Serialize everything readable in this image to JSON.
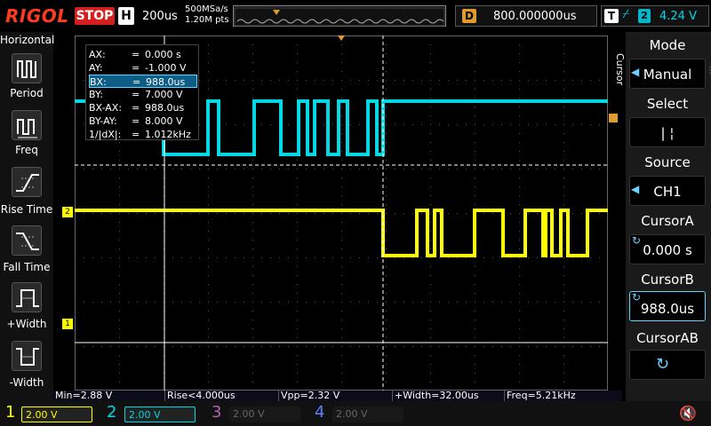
{
  "brand": "RIGOL",
  "run_state": "STOP",
  "horizontal": {
    "label": "H",
    "timebase": "200us",
    "sample_rate": "500MSa/s",
    "points": "1.20M pts"
  },
  "delay": {
    "label": "D",
    "value": "800.000000us"
  },
  "trigger": {
    "label": "T",
    "edge_icon": "rising-edge-icon",
    "channel": "2",
    "level": "4.24 V"
  },
  "left_menu": {
    "title": "Horizontal",
    "items": [
      {
        "label": "Period",
        "icon": "period-icon"
      },
      {
        "label": "Freq",
        "icon": "freq-icon"
      },
      {
        "label": "Rise Time",
        "icon": "rise-time-icon"
      },
      {
        "label": "Fall Time",
        "icon": "fall-time-icon"
      },
      {
        "label": "+Width",
        "icon": "plus-width-icon"
      },
      {
        "label": "-Width",
        "icon": "minus-width-icon"
      }
    ]
  },
  "cursor_table": [
    {
      "key": "AX:",
      "eq": "=",
      "val": "0.000 s"
    },
    {
      "key": "AY:",
      "eq": "=",
      "val": "-1.000 V"
    },
    {
      "key": "BX:",
      "eq": "=",
      "val": "988.0us"
    },
    {
      "key": "BY:",
      "eq": "=",
      "val": "7.000 V"
    },
    {
      "key": "BX-AX:",
      "eq": "=",
      "val": "988.0us"
    },
    {
      "key": "BY-AY:",
      "eq": "=",
      "val": "8.000 V"
    },
    {
      "key": "1/|dX|:",
      "eq": "=",
      "val": "1.012kHz"
    }
  ],
  "right_menu": {
    "side_label": "Cursor",
    "items": [
      {
        "head": "Mode",
        "value": "Manual"
      },
      {
        "head": "Select",
        "value": "|   ¦"
      },
      {
        "head": "Source",
        "value": "CH1"
      },
      {
        "head": "CursorA",
        "value": "0.000 s"
      },
      {
        "head": "CursorB",
        "value": "988.0us"
      },
      {
        "head": "CursorAB",
        "value": ""
      }
    ]
  },
  "channel_markers": {
    "ch2": "2",
    "ch1": "1"
  },
  "measurements": [
    {
      "text": "Min=2.88 V"
    },
    {
      "text": "Rise<4.000us"
    },
    {
      "text": "Vpp=2.32 V"
    },
    {
      "text": "+Width=32.00us"
    },
    {
      "text": "Freq=5.21kHz"
    }
  ],
  "channels": [
    {
      "num": "1",
      "scale": "2.00 V",
      "color": "#ffff00",
      "active": true
    },
    {
      "num": "2",
      "scale": "2.00 V",
      "color": "#00d8e6",
      "active": true
    },
    {
      "num": "3",
      "scale": "2.00 V",
      "color": "#b060b0",
      "active": false
    },
    {
      "num": "4",
      "scale": "2.00 V",
      "color": "#6080ff",
      "active": false
    }
  ],
  "colors": {
    "ch1": "#ffff00",
    "ch2": "#00d8e6",
    "accent": "#e09a2d",
    "brand": "#ff3b1f"
  }
}
